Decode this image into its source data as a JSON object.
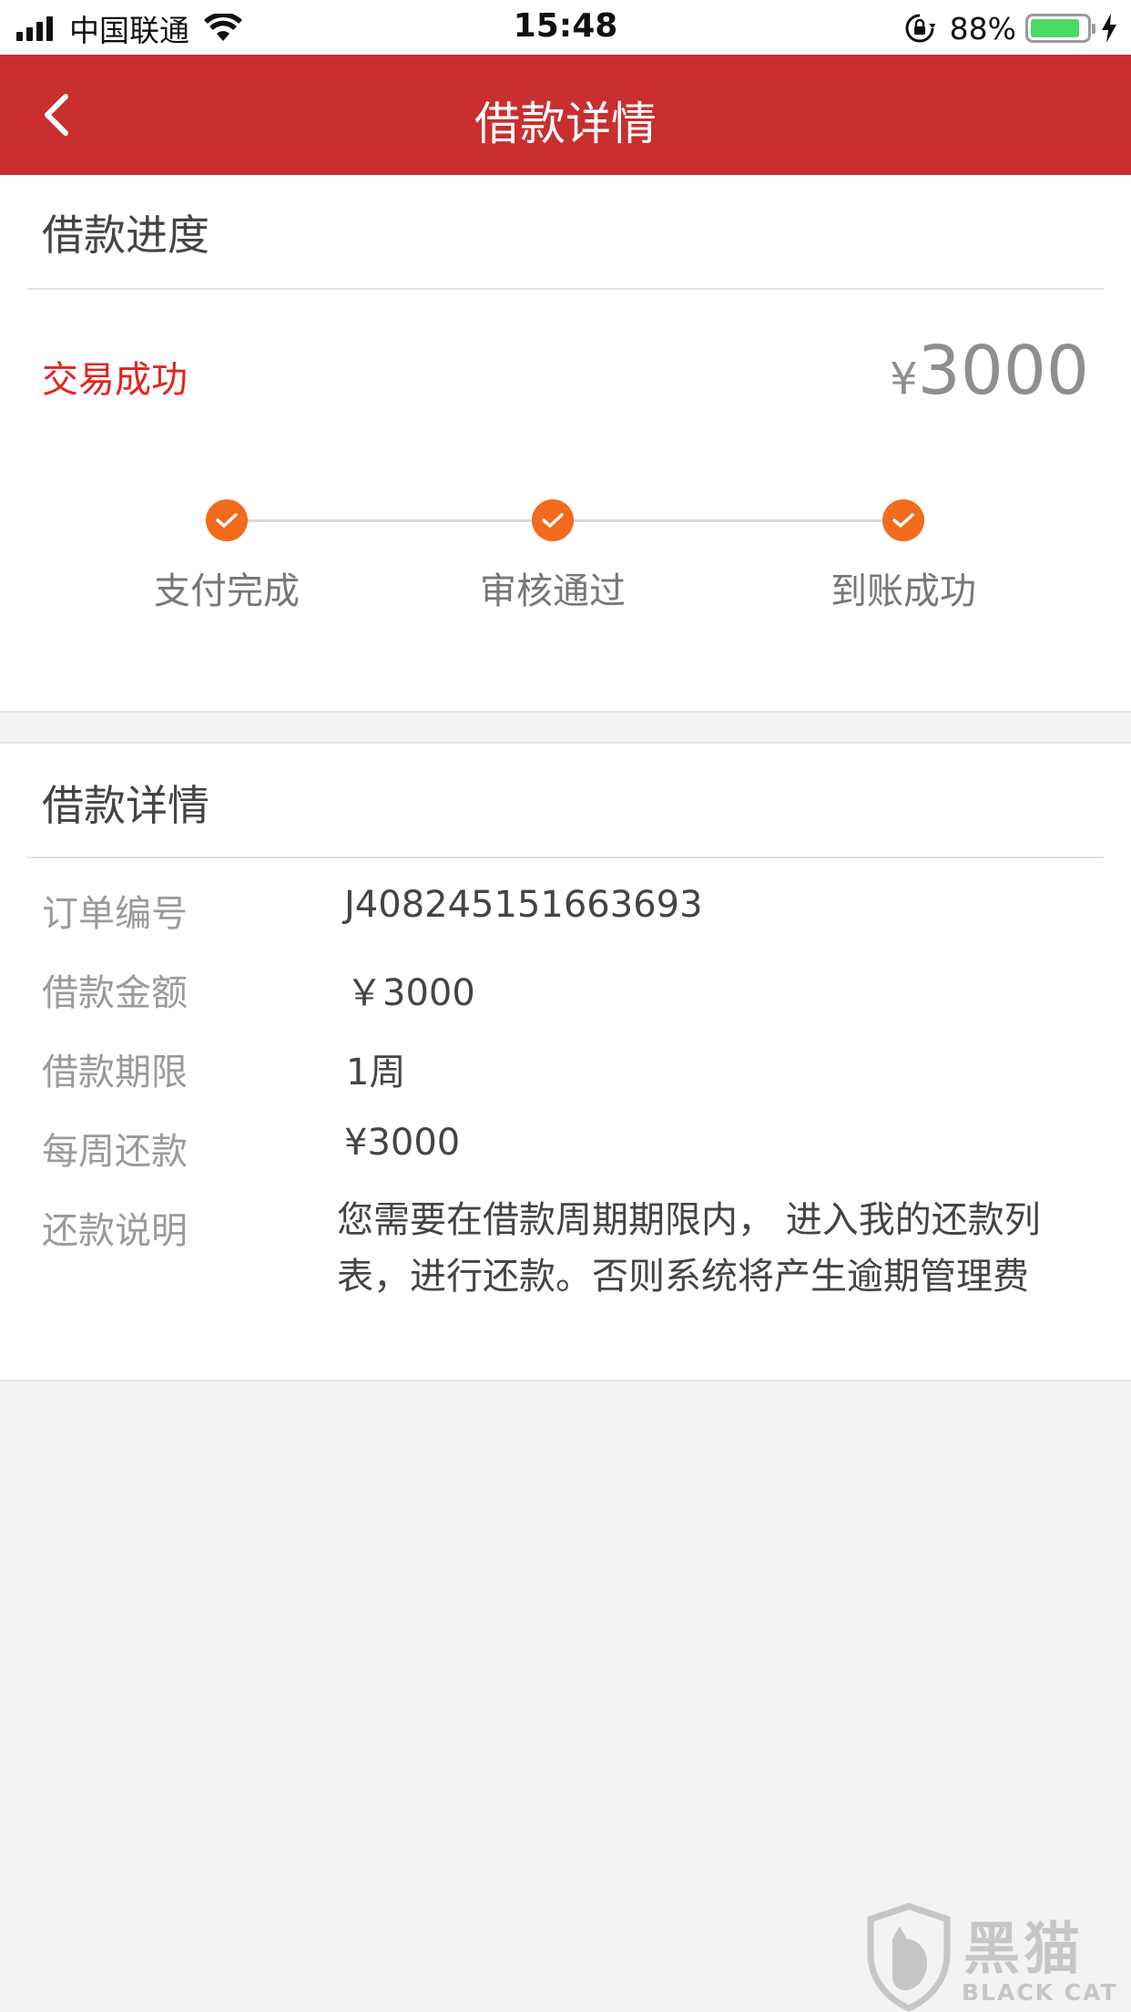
{
  "status_bar": {
    "carrier": "中国联通",
    "time": "15:48",
    "battery_percent": "88%",
    "battery_level": 0.88
  },
  "nav": {
    "title": "借款详情"
  },
  "progress": {
    "section_title": "借款进度",
    "status": "交易成功",
    "currency": "¥",
    "amount": "3000",
    "steps": [
      {
        "label": "支付完成",
        "done": true
      },
      {
        "label": "审核通过",
        "done": true
      },
      {
        "label": "到账成功",
        "done": true
      }
    ]
  },
  "details": {
    "section_title": "借款详情",
    "rows": [
      {
        "key": "订单编号",
        "value": "J408245151663693"
      },
      {
        "key": "借款金额",
        "value": "￥3000"
      },
      {
        "key": "借款期限",
        "value": "1周"
      },
      {
        "key": "每周还款",
        "value": "¥3000"
      },
      {
        "key": "还款说明",
        "value": "您需要在借款周期期限内， 进入我的还款列表，进行还款。否则系统将产生逾期管理费"
      }
    ]
  },
  "watermark": {
    "cn": "黑猫",
    "en": "BLACK CAT"
  },
  "colors": {
    "nav_red": "#c82f2f",
    "status_red": "#e5231f",
    "step_orange": "#f26b1d",
    "battery_green": "#4cd964"
  }
}
